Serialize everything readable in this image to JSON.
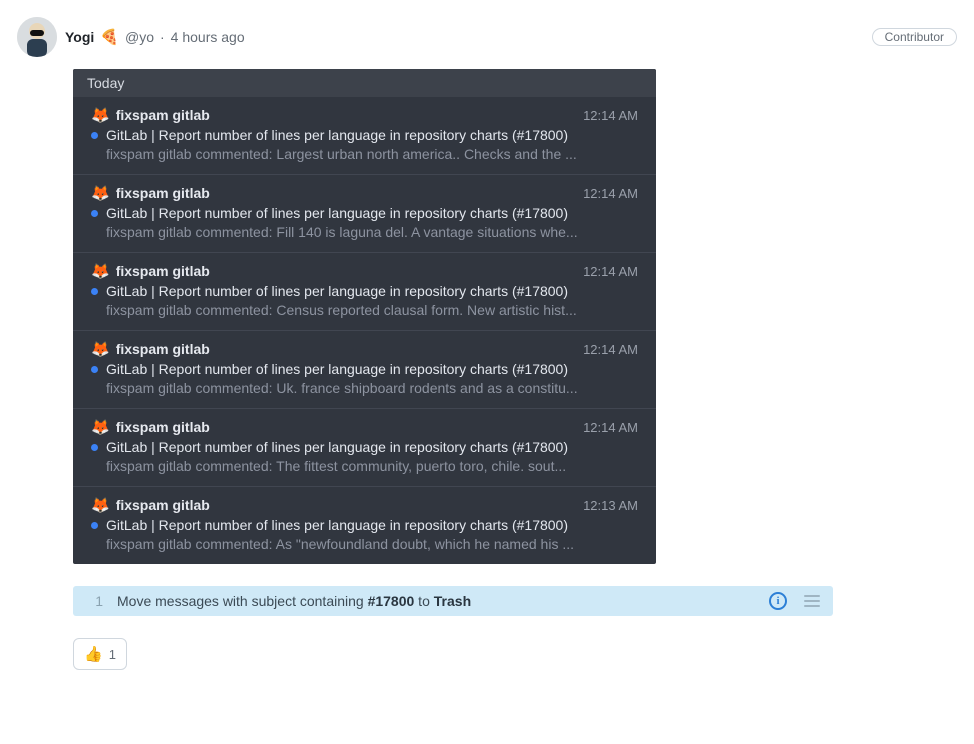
{
  "author": {
    "name": "Yogi",
    "handle": "@yo",
    "timeago": "4 hours ago",
    "badge": "Contributor"
  },
  "panel": {
    "day_header": "Today",
    "items": [
      {
        "sender": "fixspam gitlab",
        "time": "12:14 AM",
        "subject": "GitLab | Report number of lines per language in repository charts (#17800)",
        "preview": "fixspam gitlab commented: Largest urban north america.. Checks and the ..."
      },
      {
        "sender": "fixspam gitlab",
        "time": "12:14 AM",
        "subject": "GitLab | Report number of lines per language in repository charts (#17800)",
        "preview": "fixspam gitlab commented: Fill 140 is laguna del. A vantage situations whe..."
      },
      {
        "sender": "fixspam gitlab",
        "time": "12:14 AM",
        "subject": "GitLab | Report number of lines per language in repository charts (#17800)",
        "preview": "fixspam gitlab commented: Census reported clausal form. New artistic hist..."
      },
      {
        "sender": "fixspam gitlab",
        "time": "12:14 AM",
        "subject": "GitLab | Report number of lines per language in repository charts (#17800)",
        "preview": "fixspam gitlab commented: Uk. france shipboard rodents and as a constitu..."
      },
      {
        "sender": "fixspam gitlab",
        "time": "12:14 AM",
        "subject": "GitLab | Report number of lines per language in repository charts (#17800)",
        "preview": "fixspam gitlab commented: The fittest community, puerto toro, chile. sout..."
      },
      {
        "sender": "fixspam gitlab",
        "time": "12:13 AM",
        "subject": "GitLab | Report number of lines per language in repository charts (#17800)",
        "preview": "fixspam gitlab commented: As \"newfoundland doubt, which he named his ..."
      }
    ]
  },
  "suggestion": {
    "index": "1",
    "pre": "Move messages with subject containing ",
    "term": "#17800",
    "mid": " to ",
    "dest": "Trash"
  },
  "reaction": {
    "emoji": "👍",
    "count": "1"
  }
}
